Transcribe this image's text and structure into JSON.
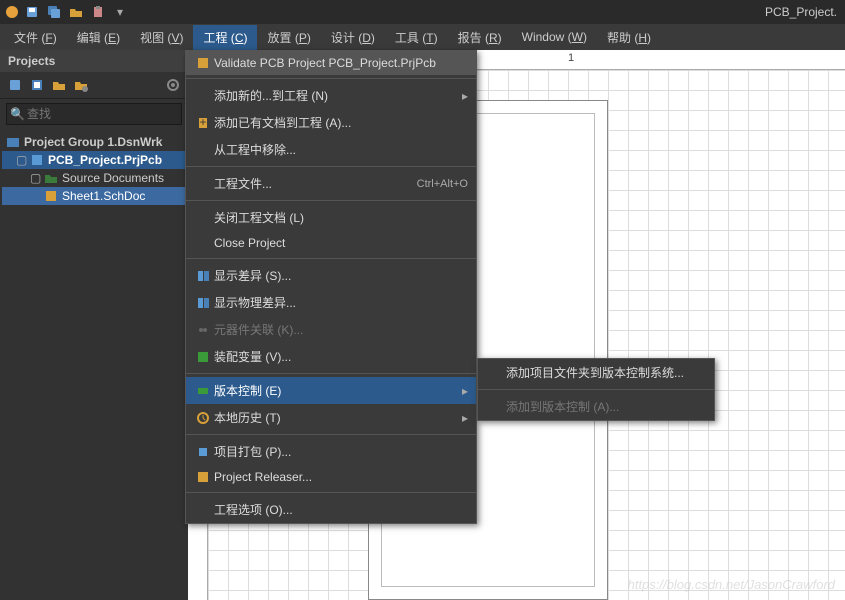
{
  "titlebar": {
    "title": "PCB_Project."
  },
  "menubar": {
    "items": [
      {
        "label": "文件",
        "key": "F"
      },
      {
        "label": "编辑",
        "key": "E"
      },
      {
        "label": "视图",
        "key": "V"
      },
      {
        "label": "工程",
        "key": "C"
      },
      {
        "label": "放置",
        "key": "P"
      },
      {
        "label": "设计",
        "key": "D"
      },
      {
        "label": "工具",
        "key": "T"
      },
      {
        "label": "报告",
        "key": "R"
      },
      {
        "label": "Window",
        "key": "W"
      },
      {
        "label": "帮助",
        "key": "H"
      }
    ]
  },
  "sidebar": {
    "title": "Projects",
    "search_placeholder": "查找",
    "tree": {
      "group": "Project Group 1.DsnWrk",
      "project": "PCB_Project.PrjPcb",
      "folder": "Source Documents",
      "file": "Sheet1.SchDoc"
    }
  },
  "dropdown": {
    "validate": "Validate PCB Project PCB_Project.PrjPcb",
    "add_new": "添加新的...到工程 (N)",
    "add_existing": "添加已有文档到工程 (A)...",
    "remove_from_project": "从工程中移除...",
    "project_files": "工程文件...",
    "project_files_shortcut": "Ctrl+Alt+O",
    "close_docs": "关闭工程文档 (L)",
    "close_project": "Close Project",
    "show_diff": "显示差异 (S)...",
    "show_phys_diff": "显示物理差异...",
    "component_links": "元器件关联 (K)...",
    "assembly_variants": "装配变量 (V)...",
    "version_control": "版本控制 (E)",
    "local_history": "本地历史 (T)",
    "project_pack": "项目打包 (P)...",
    "project_releaser": "Project Releaser...",
    "project_options": "工程选项 (O)..."
  },
  "submenu": {
    "add_folder_to_vcs": "添加项目文件夹到版本控制系统...",
    "add_to_vcs": "添加到版本控制 (A)..."
  },
  "ruler": {
    "tick1": "1"
  },
  "watermark": "https://blog.csdn.net/JasonCrawford"
}
